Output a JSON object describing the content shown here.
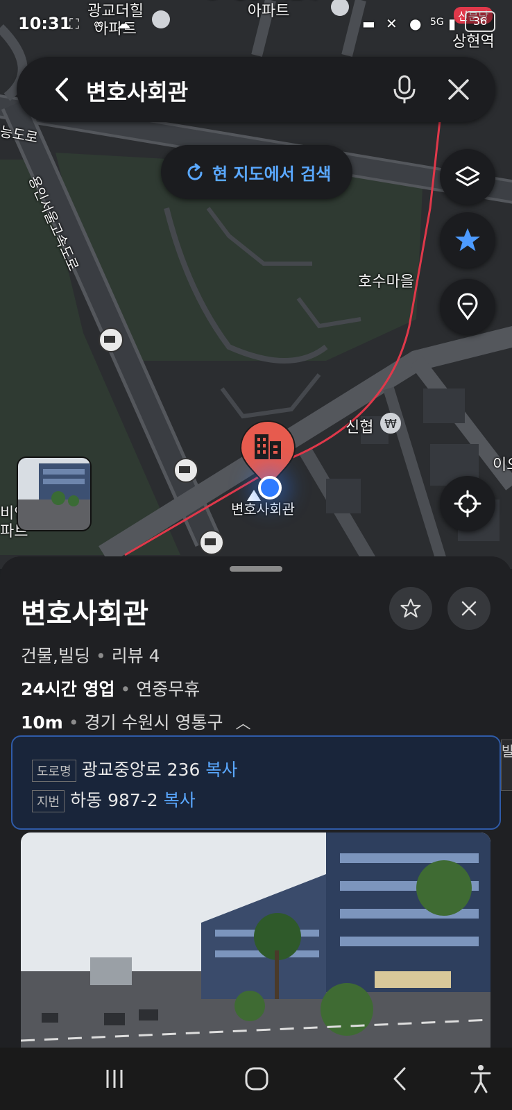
{
  "status_bar": {
    "time": "10:31",
    "battery": "36",
    "network": "5G"
  },
  "search": {
    "query": "변호사회관"
  },
  "search_area_button": {
    "label": "현 지도에서 검색"
  },
  "map": {
    "labels": {
      "gwanggyo_apt": "광교더힐\n아파트",
      "top_apt": "광교중흥에이클래스\n아파트",
      "road1": "능도로",
      "expressway": "용인서울고속도로",
      "hosu": "호수마을",
      "shinhyup": "신협",
      "marker": "변호사회관",
      "left_apt": "비인\n파트",
      "right_edge": "이오",
      "top_right_station": "상현역",
      "top_right_badge": "신분당"
    },
    "accent_colors": {
      "route": "#e0384a",
      "marker": "#e75b4e",
      "location": "#2f7bff",
      "link": "#5aa8ff"
    }
  },
  "place": {
    "name": "변호사회관",
    "category": "건물,빌딩",
    "reviews": "리뷰 4",
    "hours": "24시간 영업",
    "holiday": "연중무휴",
    "distance": "10m",
    "address_summary": "경기 수원시 영통구",
    "road_address_tag": "도로명",
    "road_address": "광교중앙로 236",
    "lot_address_tag": "지번",
    "lot_address": "하동 987-2",
    "copy_label": "복사",
    "side_tab": "발"
  }
}
